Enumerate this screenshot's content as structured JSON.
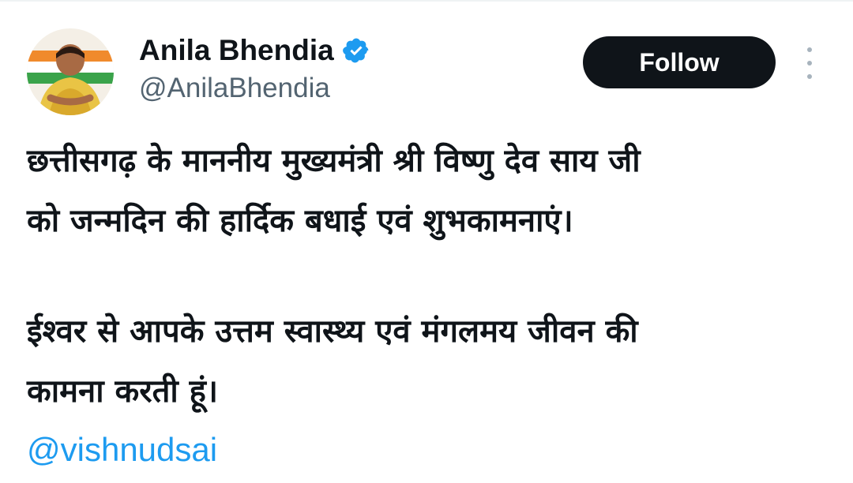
{
  "tweet": {
    "author": {
      "display_name": "Anila Bhendia",
      "handle": "@AnilaBhendia",
      "verified": true,
      "verified_color": "#1d9bf0"
    },
    "follow_label": "Follow",
    "text": {
      "line1": "छत्तीसगढ़ के माननीय मुख्यमंत्री श्री विष्णु देव साय जी",
      "line2": "को जन्मदिन की हार्दिक बधाई एवं शुभकामनाएं।",
      "line3": "ईश्वर से आपके उत्तम स्वास्थ्य एवं मंगलमय जीवन की",
      "line4": "कामना करती हूं।"
    },
    "mention": "@vishnudsai",
    "colors": {
      "text": "#0f1419",
      "secondary": "#536471",
      "link": "#1d9bf0",
      "button_bg": "#0f1419"
    }
  }
}
